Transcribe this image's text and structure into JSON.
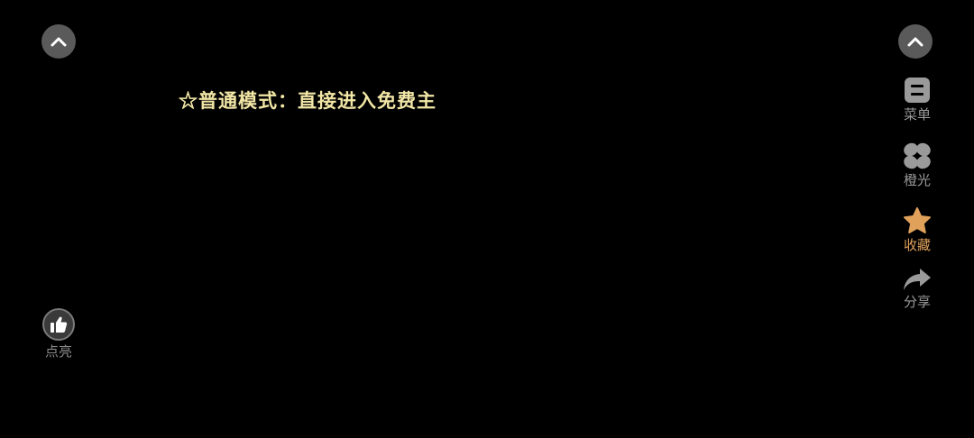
{
  "story": {
    "line": "☆普通模式：直接进入免费主"
  },
  "top_controls": {
    "left_icon": "chevron-up-icon",
    "right_icon": "chevron-up-icon"
  },
  "sidebar": {
    "items": [
      {
        "label": "菜单",
        "icon": "menu-icon"
      },
      {
        "label": "橙光",
        "icon": "orange-light-icon"
      },
      {
        "label": "收藏",
        "icon": "star-icon",
        "active": true
      },
      {
        "label": "分享",
        "icon": "share-icon"
      }
    ]
  },
  "like": {
    "label": "点亮",
    "icon": "thumbs-up-icon"
  },
  "colors": {
    "background": "#000000",
    "story_text": "#f2e6a6",
    "accent": "#e0a15a",
    "icon_gray": "#9a9a9a",
    "button_bg": "#5a5a5a"
  }
}
